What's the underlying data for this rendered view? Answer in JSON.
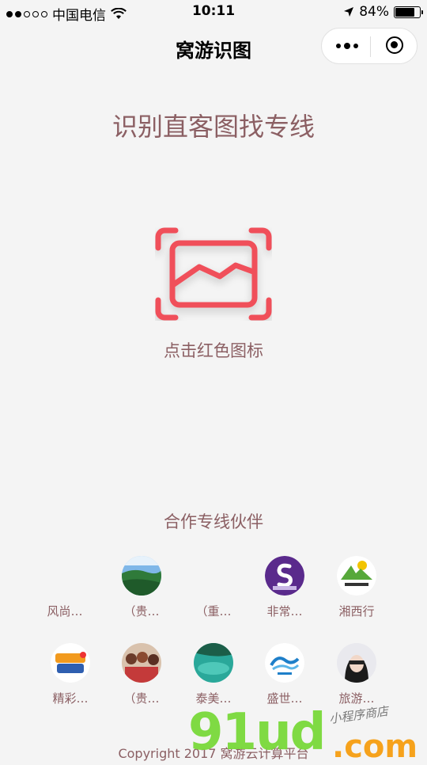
{
  "status_bar": {
    "carrier": "中国电信",
    "time": "10:11",
    "battery": "84%",
    "battery_level": 0.84
  },
  "nav": {
    "title": "窝游识图"
  },
  "main": {
    "headline": "识别直客图找专线",
    "scan_hint": "点击红色图标",
    "accent_color": "#f0505a"
  },
  "partners": {
    "title": "合作专线伙伴",
    "row1": [
      {
        "name": "风尚…",
        "avatar": "none"
      },
      {
        "name": "（贵…",
        "avatar": "landscape"
      },
      {
        "name": "（重…",
        "avatar": "none"
      },
      {
        "name": "非常…",
        "avatar": "purple-s-logo"
      },
      {
        "name": "湘西行",
        "avatar": "green-mountain-logo"
      }
    ],
    "row2": [
      {
        "name": "精彩…",
        "avatar": "colorful-logo"
      },
      {
        "name": "（贵…",
        "avatar": "group-photo"
      },
      {
        "name": "泰美…",
        "avatar": "lagoon"
      },
      {
        "name": "盛世…",
        "avatar": "wave-logo"
      },
      {
        "name": "旅游…",
        "avatar": "person-photo"
      }
    ]
  },
  "footer": {
    "copyright": "Copyright 2017 窝游云计算平台"
  },
  "watermark": {
    "brand": "91ud",
    "domain": ".com",
    "tagline": "小程序商店"
  }
}
